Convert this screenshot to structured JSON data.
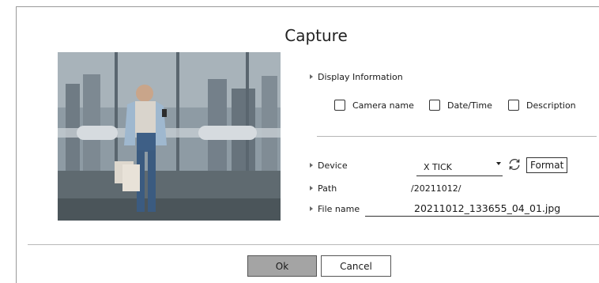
{
  "dialog": {
    "title": "Capture"
  },
  "display_information": {
    "label": "Display Information",
    "options": [
      {
        "label": "Camera name",
        "checked": false
      },
      {
        "label": "Date/Time",
        "checked": false
      },
      {
        "label": "Description",
        "checked": false
      }
    ]
  },
  "device": {
    "label": "Device",
    "value": "X TICK",
    "format_label": "Format"
  },
  "path": {
    "label": "Path",
    "value": "/20211012/"
  },
  "file_name": {
    "label": "File name",
    "value": "20211012_133655_04_01.jpg"
  },
  "buttons": {
    "ok": "Ok",
    "cancel": "Cancel"
  },
  "icons": {
    "refresh": "refresh-icon",
    "dropdown": "chevron-down-icon",
    "bullet": "caret-right-icon"
  }
}
